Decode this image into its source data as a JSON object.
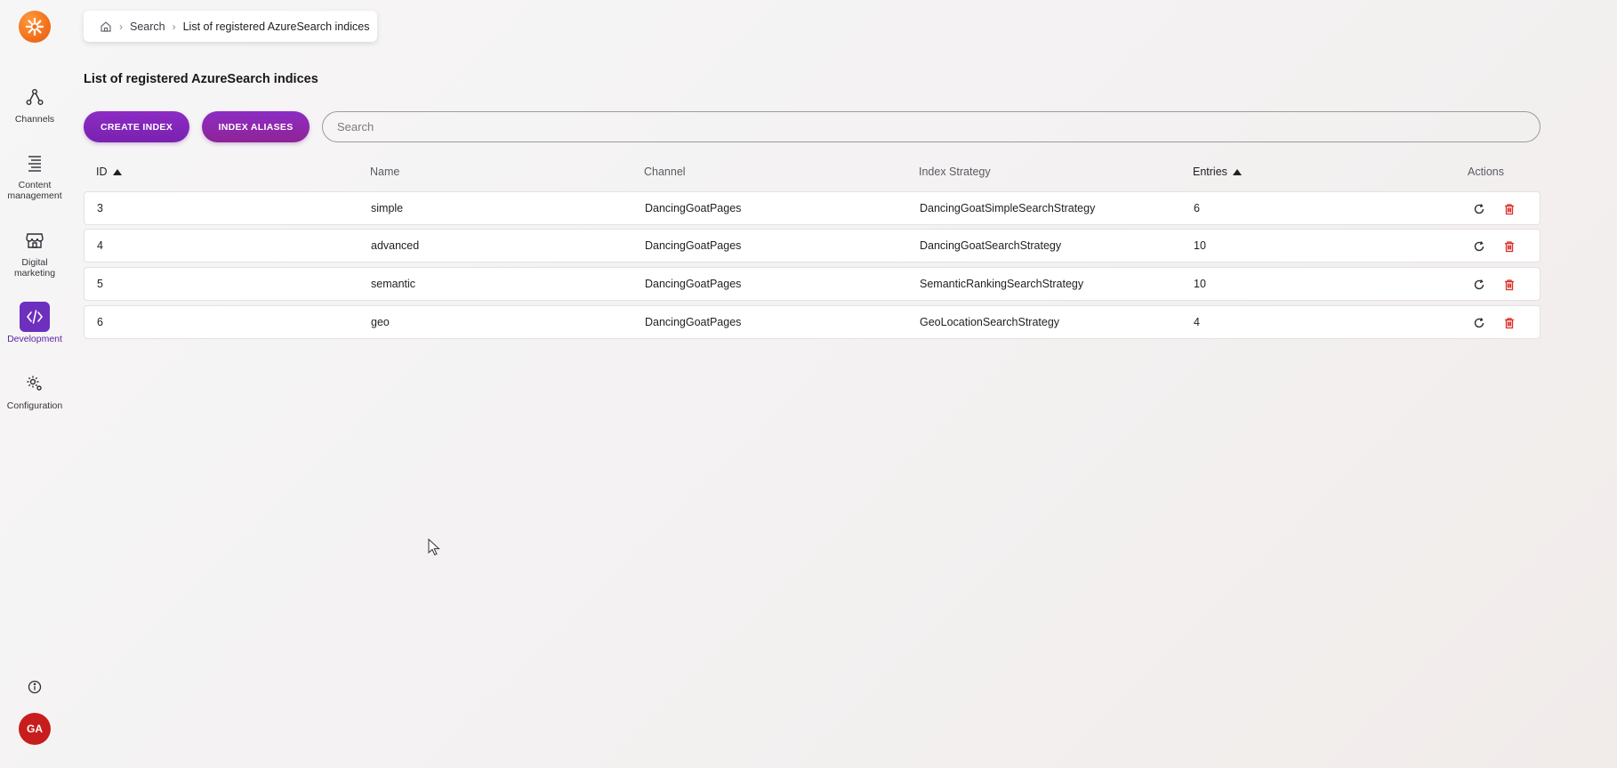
{
  "sidebar": {
    "items": [
      {
        "label": "Channels",
        "icon": "channels-icon"
      },
      {
        "label": "Content management",
        "icon": "content-icon"
      },
      {
        "label": "Digital marketing",
        "icon": "store-icon"
      },
      {
        "label": "Development",
        "icon": "code-icon",
        "active": true
      },
      {
        "label": "Configuration",
        "icon": "gear-icon"
      }
    ],
    "avatar_initials": "GA"
  },
  "breadcrumb": {
    "items": [
      "Search",
      "List of registered AzureSearch indices"
    ]
  },
  "page": {
    "title": "List of registered AzureSearch indices"
  },
  "toolbar": {
    "create_label": "CREATE INDEX",
    "aliases_label": "INDEX ALIASES",
    "search_placeholder": "Search"
  },
  "table": {
    "columns": [
      "ID",
      "Name",
      "Channel",
      "Index Strategy",
      "Entries",
      "Actions"
    ],
    "sorted_columns": [
      "ID",
      "Entries"
    ],
    "rows": [
      {
        "id": "3",
        "name": "simple",
        "channel": "DancingGoatPages",
        "strategy": "DancingGoatSimpleSearchStrategy",
        "entries": "6"
      },
      {
        "id": "4",
        "name": "advanced",
        "channel": "DancingGoatPages",
        "strategy": "DancingGoatSearchStrategy",
        "entries": "10"
      },
      {
        "id": "5",
        "name": "semantic",
        "channel": "DancingGoatPages",
        "strategy": "SemanticRankingSearchStrategy",
        "entries": "10"
      },
      {
        "id": "6",
        "name": "geo",
        "channel": "DancingGoatPages",
        "strategy": "GeoLocationSearchStrategy",
        "entries": "4"
      }
    ]
  },
  "colors": {
    "accent": "#7a21b0",
    "active_nav": "#6d2fbd",
    "logo": "#f2711c",
    "avatar": "#c71d1d",
    "delete": "#d9322b"
  }
}
